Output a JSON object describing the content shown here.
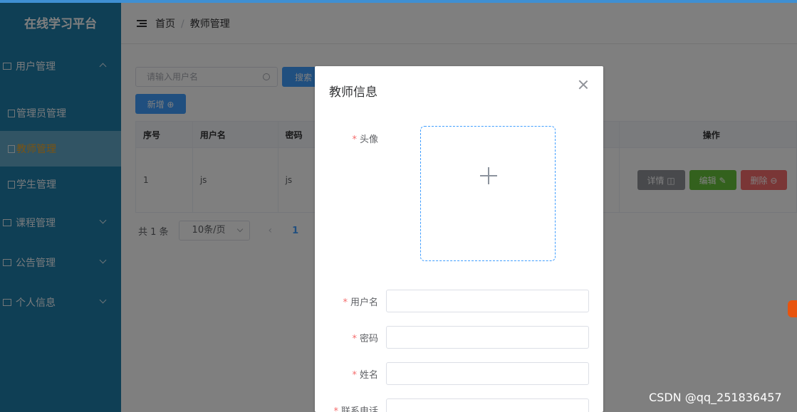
{
  "sidebar": {
    "brand": "在线学习平台",
    "menus": [
      {
        "label": "用户管理"
      },
      {
        "label": "管理员管理"
      },
      {
        "label": "教师管理"
      },
      {
        "label": "学生管理"
      },
      {
        "label": "课程管理"
      },
      {
        "label": "公告管理"
      },
      {
        "label": "个人信息"
      }
    ]
  },
  "header": {
    "breadcrumb": [
      "首页",
      "教师管理"
    ]
  },
  "toolbar": {
    "search_placeholder": "请输入用户名",
    "search_label": "搜索",
    "add_label": "新增 ⊕"
  },
  "table": {
    "columns": [
      "序号",
      "用户名",
      "密码",
      "操作"
    ],
    "rows": [
      {
        "index": "1",
        "username": "js",
        "password": "js"
      }
    ],
    "actions": {
      "detail": "详情 ◫",
      "edit": "编辑 ✎",
      "delete": "删除 ⊖"
    }
  },
  "pagination": {
    "total": "共 1 条",
    "page_size": "10条/页",
    "current_page": "1"
  },
  "dialog": {
    "title": "教师信息",
    "fields": [
      {
        "label": "头像"
      },
      {
        "label": "用户名"
      },
      {
        "label": "密码"
      },
      {
        "label": "姓名"
      },
      {
        "label": "联系电话"
      }
    ]
  },
  "watermark": "CSDN @qq_251836457"
}
